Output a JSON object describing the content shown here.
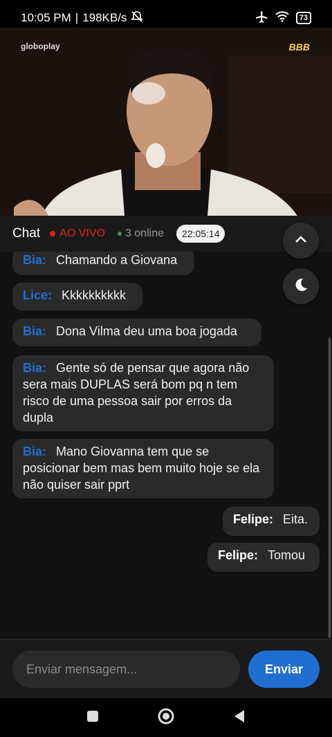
{
  "status": {
    "time": "10:05 PM",
    "speed": "198KB/s",
    "battery": "73"
  },
  "video": {
    "watermark_left": "globoplay",
    "watermark_right": "BBB"
  },
  "chat_header": {
    "title": "Chat",
    "live": "AO VIVO",
    "online": "3 online",
    "time": "22:05:14"
  },
  "messages": [
    {
      "user": "Bia:",
      "text": "Chamando a Giovana"
    },
    {
      "user": "Lice:",
      "text": "Kkkkkkkkkk"
    },
    {
      "user": "Bia:",
      "text": "Dona Vilma deu uma boa jogada"
    },
    {
      "user": "Bia:",
      "text": "Gente só de pensar que agora não sera mais DUPLAS será bom pq n tem risco de uma pessoa sair por erros da dupla"
    },
    {
      "user": "Bia:",
      "text": "Mano Giovanna tem que se posicionar bem mas bem muito hoje se ela não quiser sair pprt"
    },
    {
      "user": "Felipe:",
      "text": "Eita."
    },
    {
      "user": "Felipe:",
      "text": "Tomou"
    }
  ],
  "composer": {
    "placeholder": "Enviar mensagem...",
    "send_label": "Enviar"
  },
  "colors": {
    "accent": "#1e6fd0",
    "live": "#e61e1e",
    "online": "#2ea043"
  }
}
